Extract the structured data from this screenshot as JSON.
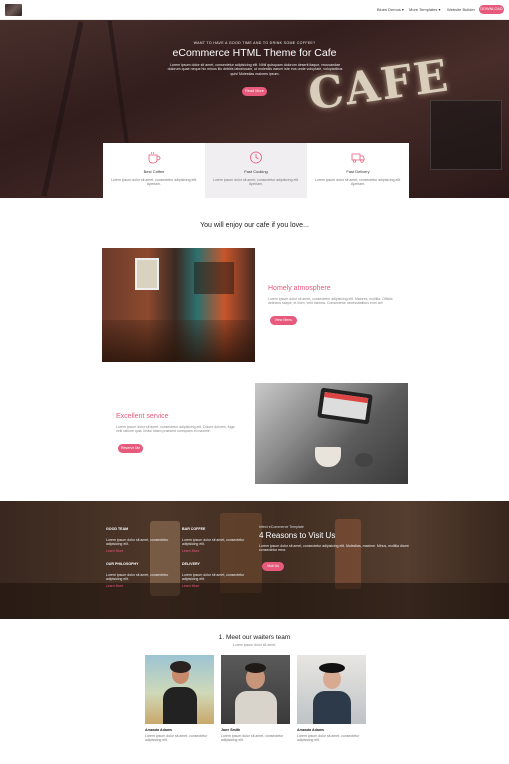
{
  "nav": {
    "links": [
      "Blues Demos ▾",
      "More Templates ▾",
      "Website Builder"
    ],
    "cta": "DOWNLOAD"
  },
  "hero": {
    "small": "WANT TO HAVE A GOOD TIME AND TO DRINK SOME COFFEE?",
    "title": "eCommerce HTML Theme for Cafe",
    "desc": "Lorem ipsum dolor sit amet, consectetur adipisicing elit. Nihil quisquam dolorum deserit itaque, recusandae dolorum quae neque hic minus illo debitis laboriosam, ut molestiis earum iste eos unde voluptate, voluptatibus quis! Molestias maiores ipsum.",
    "button": "Read More",
    "sign": "CAFE"
  },
  "features": [
    {
      "title": "Best Coffee",
      "desc": "Lorem ipsum dolor sit amet, consectetur adipisicing elit. Aperiam."
    },
    {
      "title": "Fast Cooking",
      "desc": "Lorem ipsum dolor sit amet, consectetur adipisicing elit. Aperiam."
    },
    {
      "title": "Fast Delivery",
      "desc": "Lorem ipsum dolor sit amet, consectetur adipisicing elit. Aperiam."
    }
  ],
  "enjoy": {
    "title": "You will enjoy our cafe if you love..."
  },
  "homely": {
    "title": "Homely atmosphere",
    "desc": "Lorem ipsum dolor sit amet, consectetur adipisicing elit. Maiores, mollitia. Officiis delectus saepe, et illum, velit minima. Consectetur necessitatibus eum ad!",
    "button": "View Menu"
  },
  "service": {
    "title": "Excellent service",
    "desc": "Lorem ipsum dolor sit amet, consectetur adipisicing elit. Dolore dolores, fuga velit ratione quia. Imasi totam praesent numquam et maxime.",
    "button": "Reserve Me"
  },
  "reasons": {
    "items": [
      {
        "title": "GOOD TEAM",
        "desc": "Lorem ipsum dolor sit amet, consectetur adipisicing elit.",
        "link": "Learn More"
      },
      {
        "title": "BAR COFFEE",
        "desc": "Lorem ipsum dolor sit amet, consectetur adipisicing elit.",
        "link": "Learn More"
      },
      {
        "title": "OUR PHILOSOPHY",
        "desc": "Lorem ipsum dolor sit amet, consectetur adipisicing elit.",
        "link": "Learn More"
      },
      {
        "title": "DELIVERY",
        "desc": "Lorem ipsum dolor sit amet, consectetur adipisicing elit.",
        "link": "Learn More"
      }
    ],
    "small": "Infect eCommerce Template",
    "title": "4 Reasons to Visit Us",
    "desc": "Lorem ipsum dolor sit amet, consectetur adipisicing elit. Molestias, maxime. Minus, mollitia diamt consectetur error.",
    "button": "Visit Us"
  },
  "team": {
    "title": "1. Meet our waiters team",
    "subtitle": "Lorem ipsum dolor sit amet.",
    "members": [
      {
        "name": "Amanda Adams",
        "desc": "Lorem ipsum dolor sit amet, consectetur adipisicing elit."
      },
      {
        "name": "Jane Smith",
        "desc": "Lorem ipsum dolor sit amet, consectetur adipisicing elit."
      },
      {
        "name": "Amanda Adams",
        "desc": "Lorem ipsum dolor sit amet, consectetur adipisicing elit."
      }
    ]
  },
  "colors": {
    "accent": "#e75a7c"
  },
  "icons": [
    "coffee-cup-icon",
    "clock-icon",
    "delivery-icon"
  ]
}
